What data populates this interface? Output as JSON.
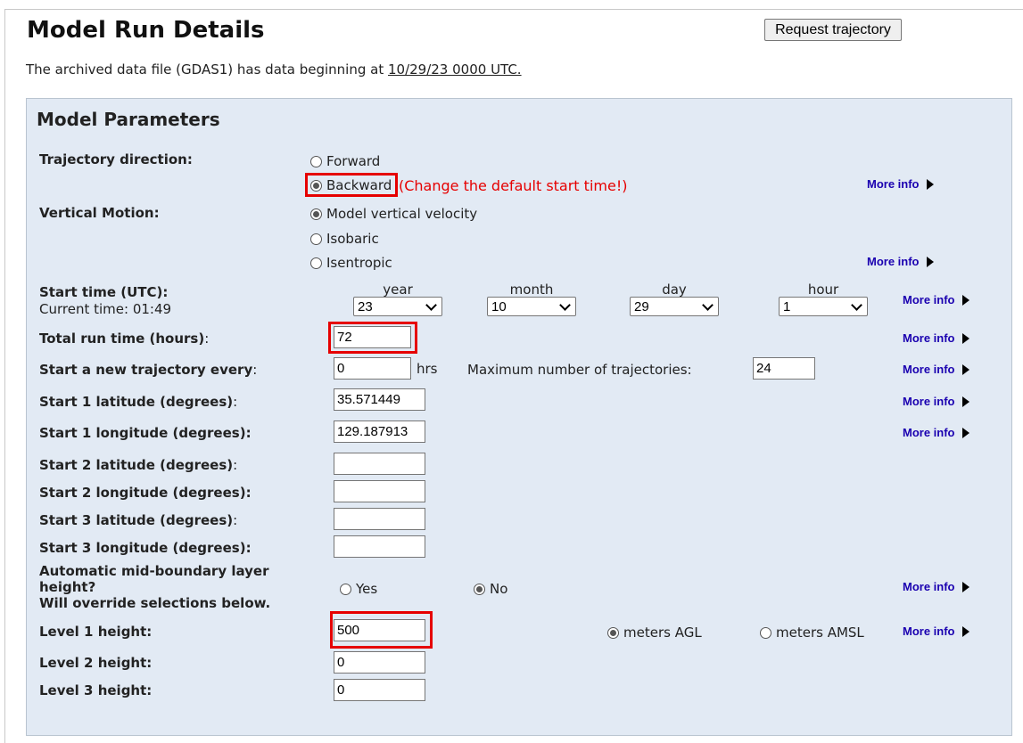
{
  "header": {
    "title": "Model Run Details",
    "request_button": "Request trajectory",
    "archive_text": "The archived data file (GDAS1) has data beginning at ",
    "archive_date": "10/29/23 0000 UTC."
  },
  "panel": {
    "title": "Model Parameters",
    "more_info": "More info",
    "direction": {
      "label": "Trajectory direction:",
      "forward": "Forward",
      "backward": "Backward",
      "selected": "Backward",
      "warning": "(Change the default start time!)"
    },
    "vertical": {
      "label": "Vertical Motion:",
      "opt1": "Model vertical velocity",
      "opt2": "Isobaric",
      "opt3": "Isentropic",
      "selected": "Model vertical velocity"
    },
    "start_time": {
      "label": "Start time (UTC):",
      "current": "Current time: 01:49",
      "year_label": "year",
      "month_label": "month",
      "day_label": "day",
      "hour_label": "hour",
      "year": "23",
      "month": "10",
      "day": "29",
      "hour": "1"
    },
    "total_run": {
      "label_bold": "Total run time (hours)",
      "label_colon": ":",
      "value": "72"
    },
    "new_every": {
      "label_bold": "Start a new trajectory every",
      "label_colon": ":",
      "value": "0",
      "unit": "hrs",
      "max_label": "Maximum number of trajectories:",
      "max_value": "24"
    },
    "start1_lat": {
      "label_bold": "Start 1 latitude (degrees)",
      "label_colon": ":",
      "value": "35.571449"
    },
    "start1_lon": {
      "label": "Start 1 longitude (degrees):",
      "value": "129.187913"
    },
    "start2_lat": {
      "label_bold": "Start 2 latitude (degrees)",
      "label_colon": ":",
      "value": ""
    },
    "start2_lon": {
      "label": "Start 2 longitude (degrees):",
      "value": ""
    },
    "start3_lat": {
      "label_bold": "Start 3 latitude (degrees)",
      "label_colon": ":",
      "value": ""
    },
    "start3_lon": {
      "label": "Start 3 longitude (degrees):",
      "value": ""
    },
    "auto_mid": {
      "line1": "Automatic mid-boundary layer",
      "line2": "height?",
      "line3": "Will override selections below.",
      "yes": "Yes",
      "no": "No",
      "selected": "No"
    },
    "level1": {
      "label": "Level 1 height:",
      "value": "500",
      "agl": "meters AGL",
      "amsl": "meters AMSL",
      "selected": "meters AGL"
    },
    "level2": {
      "label": "Level 2 height:",
      "value": "0"
    },
    "level3": {
      "label": "Level 3 height:",
      "value": "0"
    }
  },
  "colors": {
    "highlight": "#e60000",
    "panel_bg": "#e2eaf4",
    "link": "#1a00b0"
  }
}
